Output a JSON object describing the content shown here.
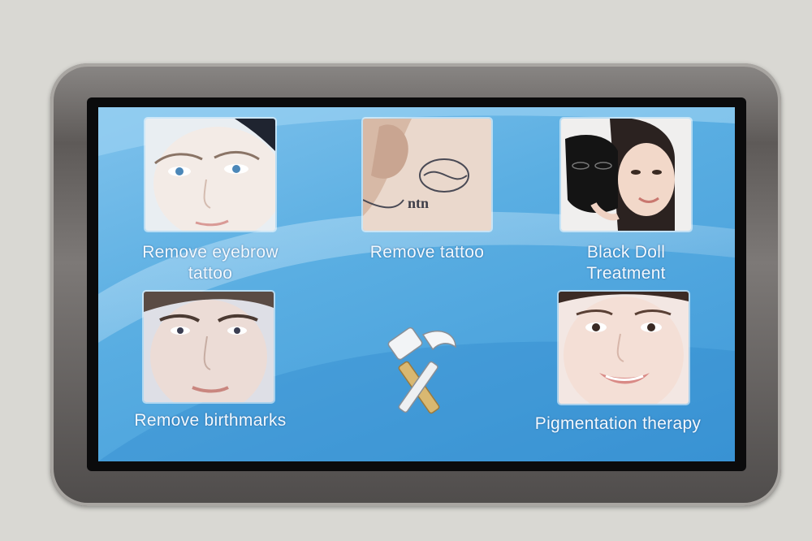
{
  "menu": {
    "items": [
      {
        "label": "Remove eyebrow\ntattoo",
        "icon": "eye-face-photo"
      },
      {
        "label": "Remove tattoo",
        "icon": "tattooed-arm-photo"
      },
      {
        "label": "Black Doll\nTreatment",
        "icon": "black-mask-photo"
      },
      {
        "label": "Remove birthmarks",
        "icon": "face-photo"
      },
      {
        "label": "Pigmentation therapy",
        "icon": "smiling-face-photo"
      }
    ],
    "center_icon": "tools-icon"
  },
  "colors": {
    "screen_top": "#7fc2ec",
    "screen_bottom": "#3f99d8",
    "label": "#f3f9ff"
  }
}
